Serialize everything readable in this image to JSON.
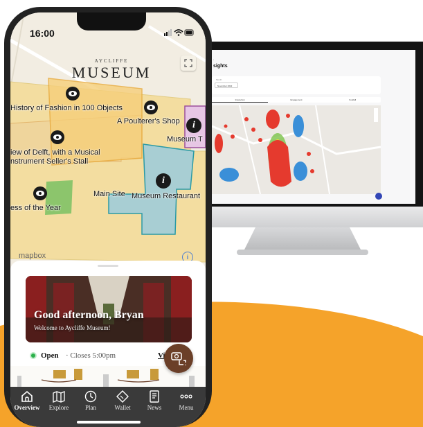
{
  "phone": {
    "status_time": "16:00",
    "logo_sub": "AYCLIFFE",
    "logo_main": "MUSEUM",
    "map_labels": {
      "history_fashion": "History of Fashion in 100 Objects",
      "poulterer": "A Poulterer's Shop",
      "museum_t": "Museum T",
      "view_delft_1": "iew of Delft, with a Musical",
      "view_delft_2": "nstrument Seller's Stall",
      "main_site": "Main Site",
      "museum_restaurant": "Museum Restaurant",
      "of_the_year": "ess of the Year"
    },
    "mapbox": "mapbox",
    "attribution": "i",
    "info_glyph": "i",
    "hero_title": "Good afternoon, Bryan",
    "hero_subtitle": "Welcome to Aycliffe Museum!",
    "open_status": "Open",
    "open_hours": "· Closes 5:00pm",
    "view_link": "Viev",
    "tabs": [
      {
        "label": "Overview",
        "icon": "home-icon"
      },
      {
        "label": "Explore",
        "icon": "map-icon"
      },
      {
        "label": "Plan",
        "icon": "clock-icon"
      },
      {
        "label": "Wallet",
        "icon": "ticket-icon"
      },
      {
        "label": "News",
        "icon": "newspaper-icon"
      },
      {
        "label": "Menu",
        "icon": "more-icon"
      }
    ]
  },
  "dashboard": {
    "title": "sights",
    "filter_label": "Month",
    "filter_value": "November 2022",
    "tabs": [
      "Interaction",
      "Engagement",
      "Footfall"
    ]
  },
  "colors": {
    "accent_orange": "#f5a32a",
    "brand_brown": "#6b3f28",
    "tabbar": "#3a3a3a",
    "open_green": "#2bb04a"
  }
}
